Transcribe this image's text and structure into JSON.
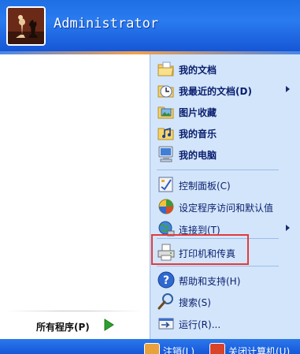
{
  "user": {
    "name": "Administrator"
  },
  "left_panel": {
    "all_programs": "所有程序(P)"
  },
  "right_panel": {
    "items": [
      {
        "label": "我的文档",
        "icon": "my-documents-icon"
      },
      {
        "label": "我最近的文档(D)",
        "icon": "recent-documents-icon",
        "submenu": true
      },
      {
        "label": "图片收藏",
        "icon": "my-pictures-icon"
      },
      {
        "label": "我的音乐",
        "icon": "my-music-icon"
      },
      {
        "label": "我的电脑",
        "icon": "my-computer-icon"
      },
      {
        "label": "控制面板(C)",
        "icon": "control-panel-icon"
      },
      {
        "label": "设定程序访问和默认值",
        "icon": "program-access-icon"
      },
      {
        "label": "连接到(T)",
        "icon": "connect-to-icon",
        "submenu": true
      },
      {
        "label": "打印机和传真",
        "icon": "printer-icon"
      },
      {
        "label": "帮助和支持(H)",
        "icon": "help-icon"
      },
      {
        "label": "搜索(S)",
        "icon": "search-icon"
      },
      {
        "label": "运行(R)...",
        "icon": "run-icon"
      }
    ]
  },
  "footer": {
    "logoff": "注销(L)",
    "shutdown": "关闭计算机(U)"
  },
  "colors": {
    "header_blue": "#1f6fe4",
    "right_panel_bg": "#d3e5fa",
    "highlight_red": "#e23b3b"
  }
}
